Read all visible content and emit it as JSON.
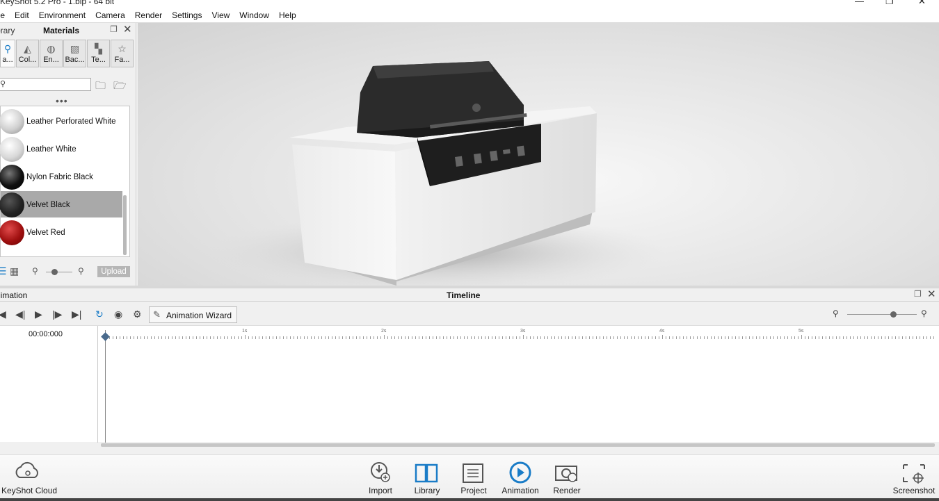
{
  "title_bar": {
    "title": "KeyShot 5.2 Pro  - 1.bip  - 64 bit",
    "minimize": "—",
    "maximize": "❐",
    "close": "✕"
  },
  "menu": [
    "ile",
    "Edit",
    "Environment",
    "Camera",
    "Render",
    "Settings",
    "View",
    "Window",
    "Help"
  ],
  "library_panel": {
    "library_label": "brary",
    "materials_label": "Materials",
    "tabs": [
      {
        "label": "a...",
        "icon": "materials-icon"
      },
      {
        "label": "Col...",
        "icon": "colors-icon"
      },
      {
        "label": "En...",
        "icon": "environments-icon"
      },
      {
        "label": "Bac...",
        "icon": "backplates-icon"
      },
      {
        "label": "Te...",
        "icon": "textures-icon"
      },
      {
        "label": "Fa...",
        "icon": "favorites-icon"
      }
    ],
    "search_placeholder": "",
    "materials": [
      {
        "name": "Leather Perforated White",
        "color": "#dcdcdc",
        "selected": false
      },
      {
        "name": "Leather White",
        "color": "#e6e6e6",
        "selected": false
      },
      {
        "name": "Nylon Fabric Black",
        "color": "#111111",
        "selected": false
      },
      {
        "name": "Velvet Black",
        "color": "#2a2a2a",
        "selected": true
      },
      {
        "name": "Velvet Red",
        "color": "#b01818",
        "selected": false
      }
    ],
    "upload_label": "Upload"
  },
  "timeline": {
    "animation_label": "nimation",
    "title": "Timeline",
    "wizard_label": "Animation Wizard",
    "current_time": "00:00:000",
    "ruler_labels": [
      "1s",
      "2s",
      "3s",
      "4s",
      "5s"
    ]
  },
  "dock": {
    "cloud": "KeyShot Cloud",
    "import": "Import",
    "library": "Library",
    "project": "Project",
    "animation": "Animation",
    "render": "Render",
    "screenshot": "Screenshot"
  },
  "colors": {
    "accent": "#1a7cc7",
    "selected_row": "#a9a9a9"
  }
}
